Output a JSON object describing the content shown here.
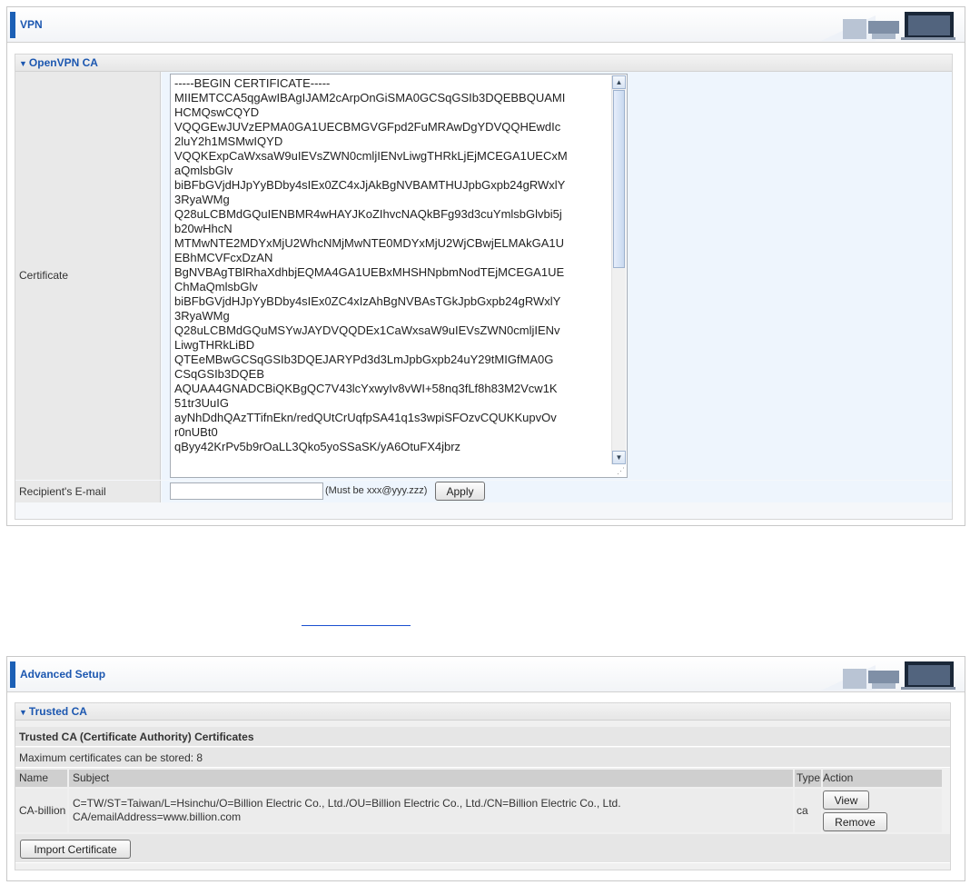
{
  "panel1": {
    "title": "VPN",
    "section_title": "OpenVPN CA",
    "certificate_label": "Certificate",
    "certificate_lines": [
      "-----BEGIN CERTIFICATE-----",
      "MIIEMTCCA5qgAwIBAgIJAM2cArpOnGiSMA0GCSqGSIb3DQEBBQUAMI",
      "HCMQswCQYD",
      "VQQGEwJUVzEPMA0GA1UECBMGVGFpd2FuMRAwDgYDVQQHEwdIc",
      "2luY2h1MSMwIQYD",
      "VQQKExpCaWxsaW9uIEVsZWN0cmljIENvLiwgTHRkLjEjMCEGA1UECxM",
      "aQmlsbGlv",
      "biBFbGVjdHJpYyBDby4sIEx0ZC4xJjAkBgNVBAMTHUJpbGxpb24gRWxlY",
      "3RyaWMg",
      "Q28uLCBMdGQuIENBMR4wHAYJKoZIhvcNAQkBFg93d3cuYmlsbGlvbi5j",
      "b20wHhcN",
      "MTMwNTE2MDYxMjU2WhcNMjMwNTE0MDYxMjU2WjCBwjELMAkGA1U",
      "EBhMCVFcxDzAN",
      "BgNVBAgTBlRhaXdhbjEQMA4GA1UEBxMHSHNpbmNodTEjMCEGA1UE",
      "ChMaQmlsbGlv",
      "biBFbGVjdHJpYyBDby4sIEx0ZC4xIzAhBgNVBAsTGkJpbGxpb24gRWxlY",
      "3RyaWMg",
      "Q28uLCBMdGQuMSYwJAYDVQQDEx1CaWxsaW9uIEVsZWN0cmljIENv",
      "LiwgTHRkLiBD",
      "QTEeMBwGCSqGSIb3DQEJARYPd3d3LmJpbGxpb24uY29tMIGfMA0G",
      "CSqGSIb3DQEB",
      "AQUAA4GNADCBiQKBgQC7V43lcYxwyIv8vWI+58nq3fLf8h83M2Vcw1K",
      "51tr3UuIG",
      "ayNhDdhQAzTTifnEkn/redQUtCrUqfpSA41q1s3wpiSFOzvCQUKKupvOv",
      "r0nUBt0",
      "qByy42KrPv5b9rOaLL3Qko5yoSSaSK/yA6OtuFX4jbrz"
    ],
    "email_label": "Recipient's E-mail",
    "email_value": "",
    "email_hint": "(Must be xxx@yyy.zzz)",
    "apply_label": "Apply"
  },
  "panel2": {
    "title": "Advanced Setup",
    "section_title": "Trusted CA",
    "heading": "Trusted CA (Certificate Authority) Certificates",
    "max_text": "Maximum certificates can be stored: 8",
    "columns": [
      "Name",
      "Subject",
      "Type",
      "Action"
    ],
    "rows": [
      {
        "name": "CA-billion",
        "subject_line1": "C=TW/ST=Taiwan/L=Hsinchu/O=Billion Electric Co., Ltd./OU=Billion Electric Co., Ltd./CN=Billion Electric Co., Ltd.",
        "subject_line2": "CA/emailAddress=www.billion.com",
        "type": "ca",
        "view_label": "View",
        "remove_label": "Remove"
      }
    ],
    "import_label": "Import Certificate"
  },
  "colors": {
    "accent": "#1c57b0",
    "bar": "#1b5fb5",
    "row_bg": "#eef5fd",
    "label_bg": "#e9e9e9"
  }
}
